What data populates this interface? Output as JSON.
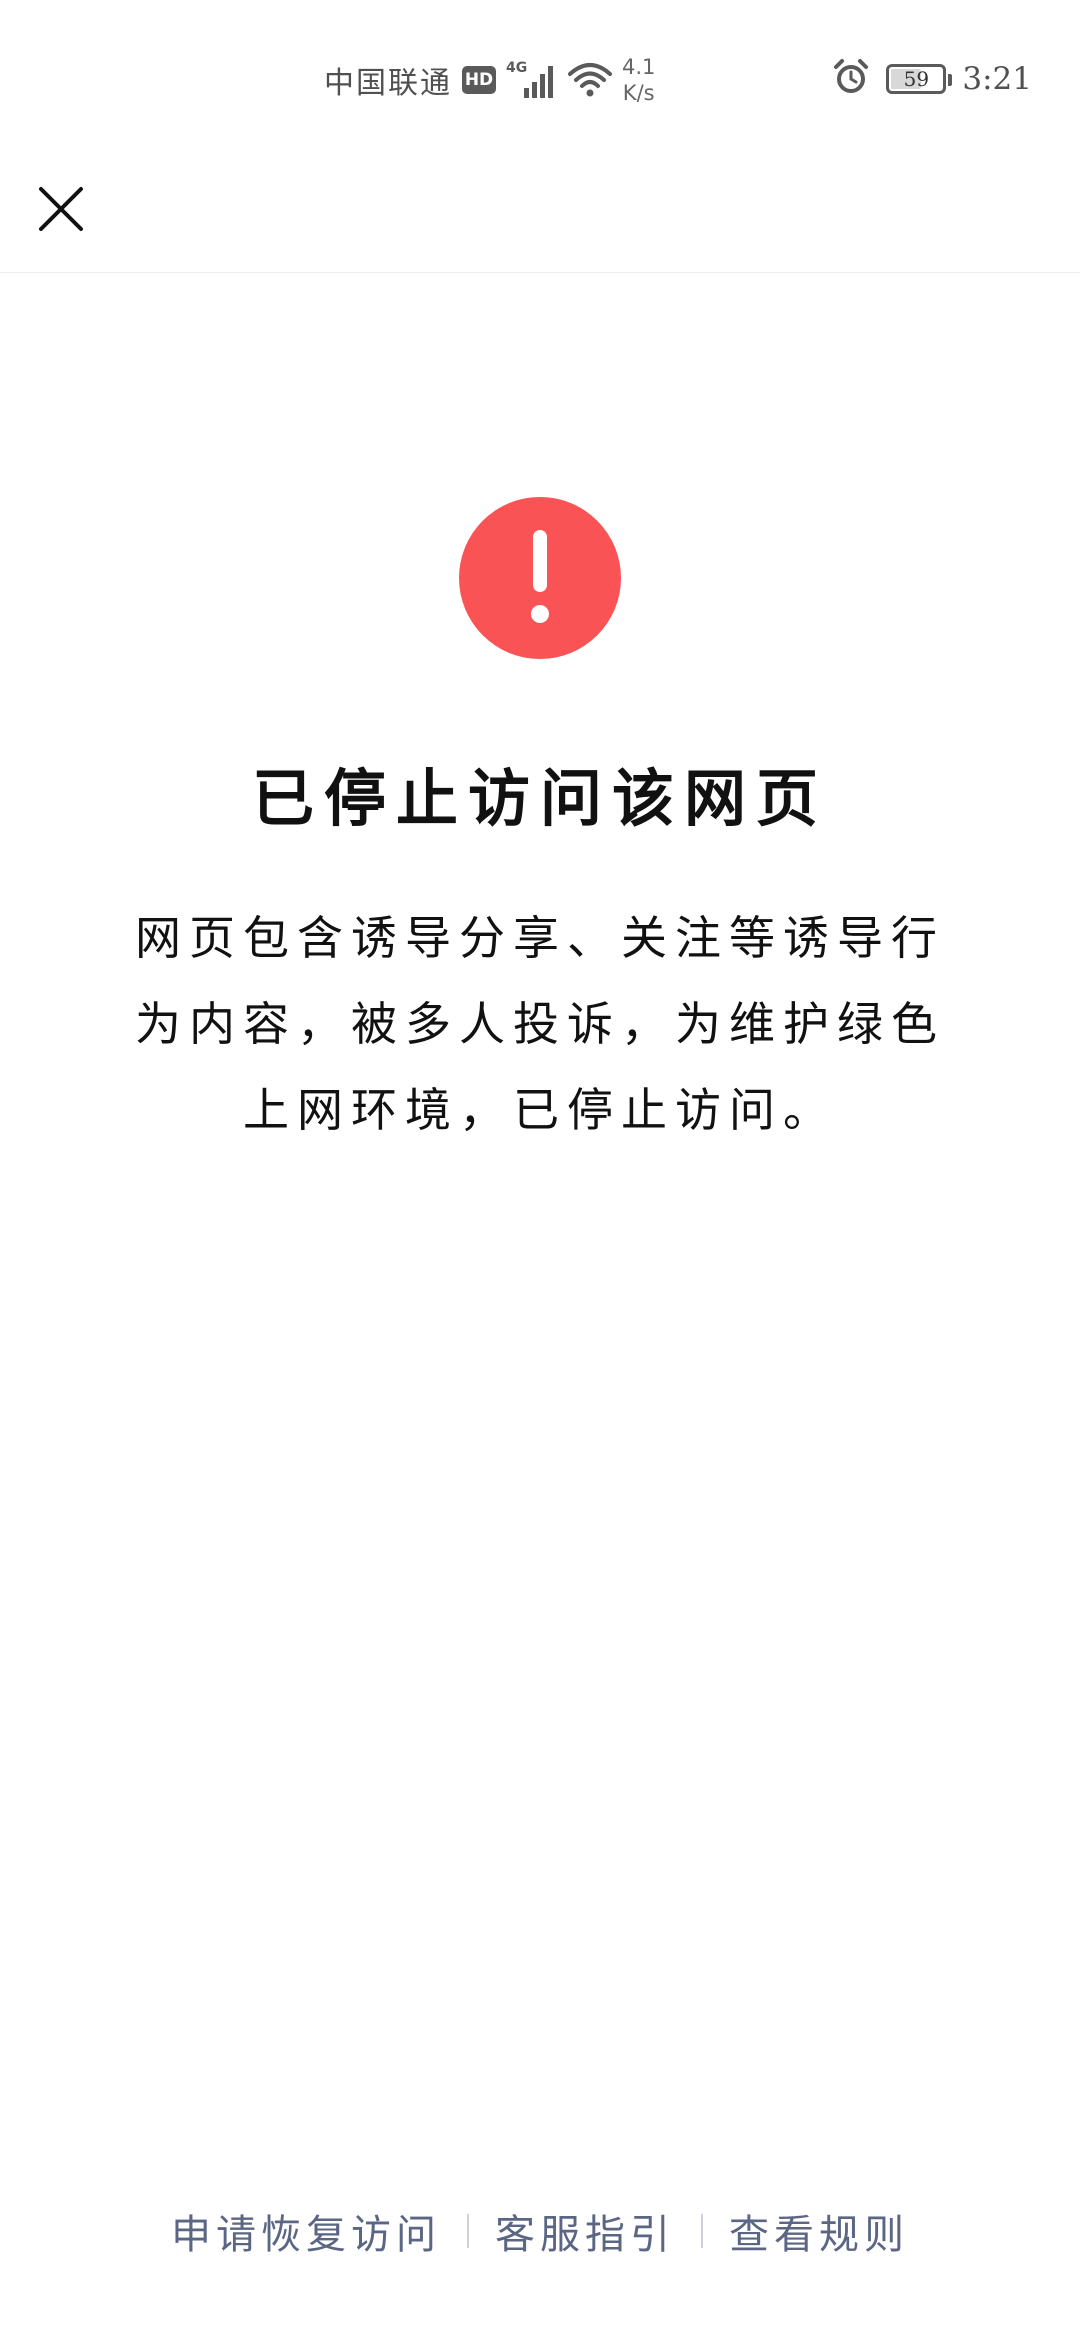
{
  "status_bar": {
    "carrier": "中国联通",
    "hd_label": "HD",
    "network_type": "4G",
    "speed_value": "4.1",
    "speed_unit": "K/s",
    "battery_level": "59",
    "battery_fraction": 0.59,
    "time": "3:21"
  },
  "page": {
    "title": "已停止访问该网页",
    "description": "网页包含诱导分享、关注等诱导行为内容，被多人投诉，为维护绿色上网环境，已停止访问。"
  },
  "footer": {
    "links": [
      {
        "label": "申请恢复访问"
      },
      {
        "label": "客服指引"
      },
      {
        "label": "查看规则"
      }
    ]
  },
  "colors": {
    "alert": "#f95355",
    "link": "#5b6684"
  },
  "icons": {
    "close": "close-icon",
    "alert": "exclamation-icon",
    "alarm": "alarm-clock-icon",
    "wifi": "wifi-icon",
    "signal": "signal-bars-icon"
  }
}
